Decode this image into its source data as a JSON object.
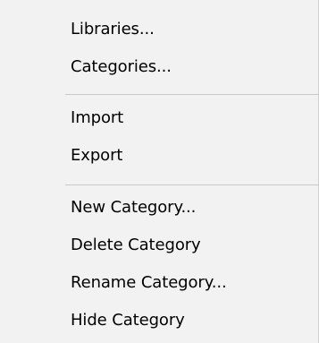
{
  "menu": {
    "items": [
      {
        "label": "Libraries..."
      },
      {
        "label": "Categories..."
      },
      {
        "label": "Import"
      },
      {
        "label": "Export"
      },
      {
        "label": "New Category..."
      },
      {
        "label": "Delete Category"
      },
      {
        "label": "Rename Category..."
      },
      {
        "label": "Hide Category"
      }
    ]
  },
  "colors": {
    "background": "#f2f2f2",
    "separator": "#c9c9c9",
    "text": "#000000"
  }
}
